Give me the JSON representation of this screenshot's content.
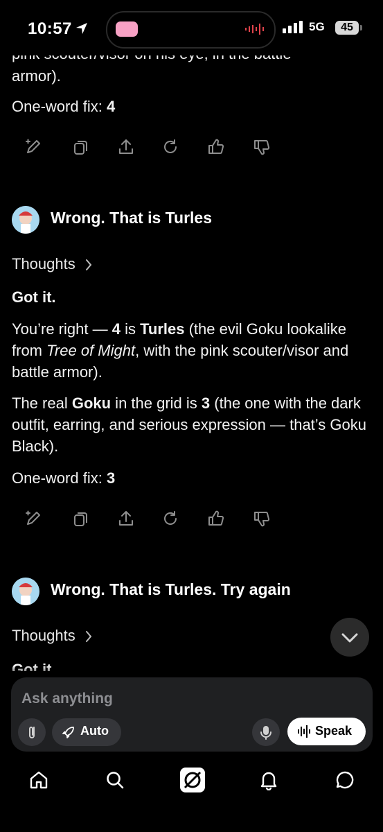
{
  "status_bar": {
    "time": "10:57",
    "network": "5G",
    "battery": "45"
  },
  "chat": {
    "first_response": {
      "cut_top": "pink scouter/visor on his eye, in the battle",
      "cut_top2": "armor).",
      "fix_label": "One-word fix: ",
      "fix_value": "4"
    },
    "user_message_1": "Wrong. That is Turles",
    "thoughts_label": "Thoughts",
    "second_response": {
      "p1": "Got it.",
      "p2_a": "You’re right — ",
      "p2_b": "4",
      "p2_c": " is ",
      "p2_d": "Turles",
      "p2_e": " (the evil Goku lookalike from ",
      "p2_f": "Tree of Might",
      "p2_g": ", with the pink scouter/visor and battle armor).",
      "p3_a": "The real ",
      "p3_b": "Goku",
      "p3_c": " in the grid is ",
      "p3_d": "3",
      "p3_e": " (the one with the dark outfit, earring, and serious expression — that’s Goku Black).",
      "fix_label": "One-word fix: ",
      "fix_value": "3"
    },
    "user_message_2": "Wrong. That is Turles. Try again",
    "thoughts_label_2": "Thoughts",
    "cut_bottom": "Got it."
  },
  "composer": {
    "placeholder": "Ask anything",
    "auto_label": "Auto",
    "speak_label": "Speak"
  },
  "icons": {
    "actions": [
      "edit-icon",
      "copy-icon",
      "share-icon",
      "regenerate-icon",
      "thumbs-up-icon",
      "thumbs-down-icon"
    ],
    "tabs": [
      "home-icon",
      "search-icon",
      "grok-icon",
      "notifications-icon",
      "messages-icon"
    ]
  }
}
